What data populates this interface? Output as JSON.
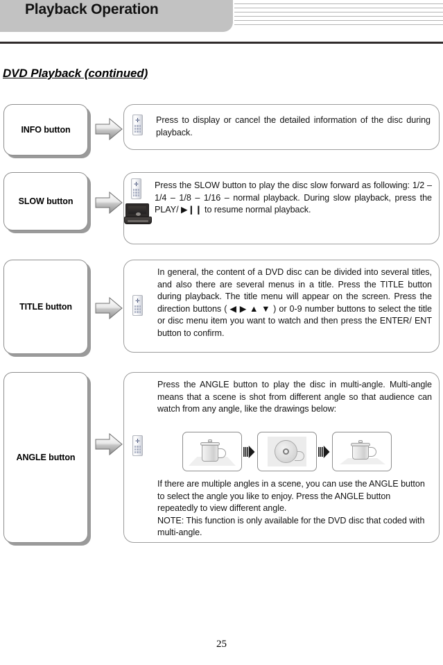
{
  "header": {
    "title": "Playback Operation",
    "decor_line_count": 6
  },
  "page_heading": "DVD Playback (continued)",
  "page_number": "25",
  "sections": [
    {
      "label": "INFO button",
      "icons": [
        "remote-control-icon"
      ],
      "text": "Press to display or cancel the detailed information of the disc during playback."
    },
    {
      "label": "SLOW button",
      "icons": [
        "remote-control-icon",
        "portable-dvd-player-icon"
      ],
      "text": "Press the SLOW button to play the disc slow forward as following: 1/2 – 1/4 – 1/8 – 1/16 – normal playback. During slow playback, press the PLAY/ ▶❙❙ to resume normal playback."
    },
    {
      "label": "TITLE button",
      "icons": [
        "remote-control-icon"
      ],
      "text": "In general, the content of a DVD disc can be divided into several titles, and also there are several menus in a title. Press the TITLE button during playback. The title menu will appear on the screen. Press the direction buttons ( ◀ ▶ ▲ ▼ ) or 0-9 number buttons to select the title or disc menu item you want to watch and then press the ENTER/ ENT button to confirm."
    },
    {
      "label": "ANGLE button",
      "icons": [
        "remote-control-icon"
      ],
      "text_top": "Press the ANGLE button to play the disc in multi-angle. Multi-angle means that a scene is shot from different angle so that audience can watch from any angle, like the drawings below:",
      "drawings": [
        {
          "caption": "mug-side-view"
        },
        {
          "caption": "mug-top-view"
        },
        {
          "caption": "mug-side-view-2"
        }
      ],
      "sequence_arrow": "striped-right-arrow-icon",
      "text_bottom": "If there are multiple angles in a scene, you can use the ANGLE button to select the angle you like to enjoy. Press the ANGLE button repeatedly to view different angle.\nNOTE: This function is only available for the DVD disc that coded with multi-angle."
    }
  ],
  "colors": {
    "header_tab": "#c2c2c2",
    "header_rule": "#2f2b2b",
    "box_border": "#8e8e8e",
    "box_shadow": "#9a9a9a",
    "text": "#111111"
  }
}
